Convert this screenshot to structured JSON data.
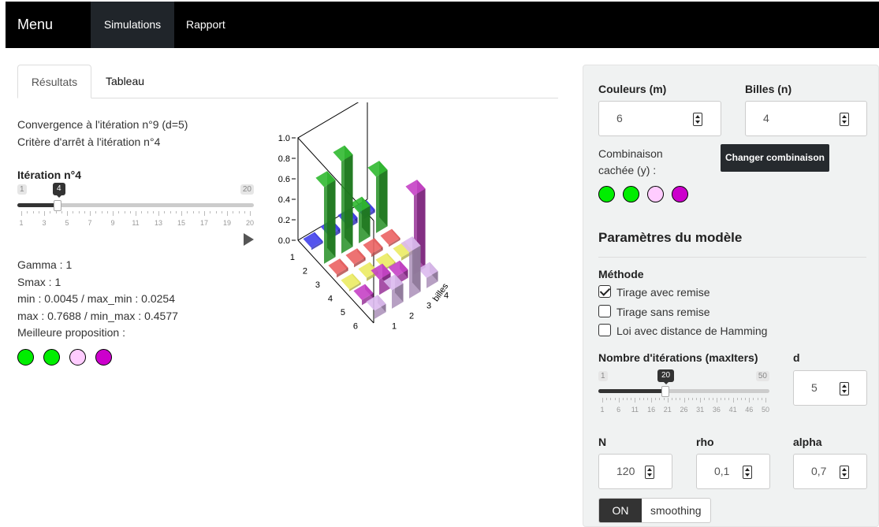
{
  "navbar": {
    "brand": "Menu",
    "items": [
      {
        "label": "Simulations",
        "active": true
      },
      {
        "label": "Rapport",
        "active": false
      }
    ]
  },
  "tabs": [
    {
      "label": "Résultats",
      "active": true
    },
    {
      "label": "Tableau",
      "active": false
    }
  ],
  "results": {
    "convergence": "Convergence à l'itération n°9 (d=5)",
    "stop": "Critère d'arrêt à l'itération n°4",
    "iteration_label": "Itération n°4",
    "iteration_slider": {
      "min": "1",
      "max": "20",
      "value": "4",
      "ticks": [
        "1",
        "3",
        "5",
        "7",
        "9",
        "11",
        "13",
        "15",
        "17",
        "19",
        "20"
      ]
    },
    "gamma": "Gamma : 1",
    "smax": "Smax : 1",
    "minmax1": "min : 0.0045 / max_min : 0.0254",
    "minmax2": "max : 0.7688 / min_max : 0.4577",
    "best_label": "Meilleure proposition :",
    "best_colors": [
      "#00ee00",
      "#00ee00",
      "#ffccff",
      "#cc00cc"
    ]
  },
  "chart_data": {
    "type": "bar3d",
    "z_ticks": [
      "0.0",
      "0.2",
      "0.4",
      "0.6",
      "0.8",
      "1.0"
    ],
    "y_ticks": [
      "1",
      "2",
      "3",
      "4",
      "5",
      "6"
    ],
    "x_ticks": [
      "1",
      "2",
      "3",
      "4"
    ],
    "x_label": "billes",
    "colors_by_row": [
      "#3b3bd6",
      "#2ca82c",
      "#d65a5a",
      "#d6d65a",
      "#b33bb3",
      "#c8a8d8"
    ],
    "values": [
      [
        0.02,
        0.04,
        0.05,
        0.03
      ],
      [
        0.75,
        0.9,
        0.3,
        0.55
      ],
      [
        0.03,
        0.03,
        0.03,
        0.02
      ],
      [
        0.02,
        0.03,
        0.02,
        0.03
      ],
      [
        0.05,
        0.15,
        0.08,
        0.77
      ],
      [
        0.08,
        0.18,
        0.45,
        0.1
      ]
    ]
  },
  "panel": {
    "couleurs_label": "Couleurs (m)",
    "couleurs_value": "6",
    "billes_label": "Billes (n)",
    "billes_value": "4",
    "hidden_label_1": "Combinaison",
    "hidden_label_2": "cachée (y) :",
    "change_button": "Changer combinaison",
    "hidden_colors": [
      "#00ee00",
      "#00ee00",
      "#ffccff",
      "#cc00cc"
    ],
    "params_title": "Paramètres du modèle",
    "method_label": "Méthode",
    "methods": [
      {
        "label": "Tirage avec remise",
        "checked": true
      },
      {
        "label": "Tirage sans remise",
        "checked": false
      },
      {
        "label": "Loi avec distance de Hamming",
        "checked": false
      }
    ],
    "iter_label": "Nombre d'itérations (maxIters)",
    "iter_slider": {
      "min": "1",
      "max": "50",
      "value": "20",
      "ticks": [
        "1",
        "6",
        "11",
        "16",
        "21",
        "26",
        "31",
        "36",
        "41",
        "46",
        "50"
      ]
    },
    "d_label": "d",
    "d_value": "5",
    "N_label": "N",
    "N_value": "120",
    "rho_label": "rho",
    "rho_value": "0,1",
    "alpha_label": "alpha",
    "alpha_value": "0,7",
    "smoothing_on": "ON",
    "smoothing_label": "smoothing"
  }
}
